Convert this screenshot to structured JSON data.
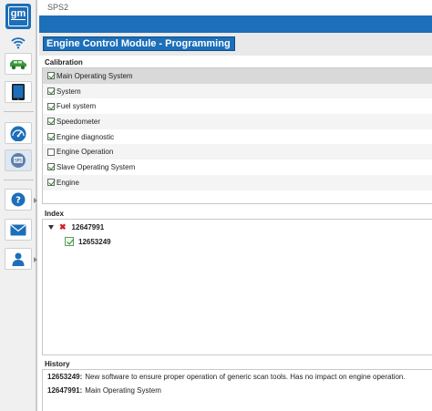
{
  "app": {
    "logo_text": "gm",
    "window_title": "SPS2"
  },
  "module": {
    "title": "Engine Control Module - Programming"
  },
  "calibration": {
    "label": "Calibration",
    "items": [
      {
        "label": "Main Operating System",
        "checked": true,
        "selected": true
      },
      {
        "label": "System",
        "checked": true,
        "selected": false
      },
      {
        "label": "Fuel system",
        "checked": true,
        "selected": false
      },
      {
        "label": "Speedometer",
        "checked": true,
        "selected": false
      },
      {
        "label": "Engine diagnostic",
        "checked": true,
        "selected": false
      },
      {
        "label": "Engine Operation",
        "checked": false,
        "selected": false
      },
      {
        "label": "Slave Operating System",
        "checked": true,
        "selected": false
      },
      {
        "label": "Engine",
        "checked": true,
        "selected": false
      }
    ]
  },
  "index": {
    "label": "Index",
    "parent": {
      "number": "12647991",
      "status_icon": "x-icon"
    },
    "child": {
      "number": "12653249",
      "status_icon": "check-icon"
    }
  },
  "history": {
    "label": "History",
    "rows": [
      {
        "number": "12653249:",
        "text": "New software to ensure proper operation of generic scan tools. Has no impact on engine operation."
      },
      {
        "number": "12647991:",
        "text": "Main Operating System"
      }
    ]
  },
  "sidebar": {
    "icons": [
      "wifi-icon",
      "vehicle-icon",
      "tablet-icon",
      "dashboard-gauge-icon",
      "sps-icon",
      "help-icon",
      "mail-icon",
      "user-icon"
    ]
  },
  "colors": {
    "accent": "#1c6fb8",
    "check": "#2a8a2a",
    "error": "#d01f1f"
  }
}
